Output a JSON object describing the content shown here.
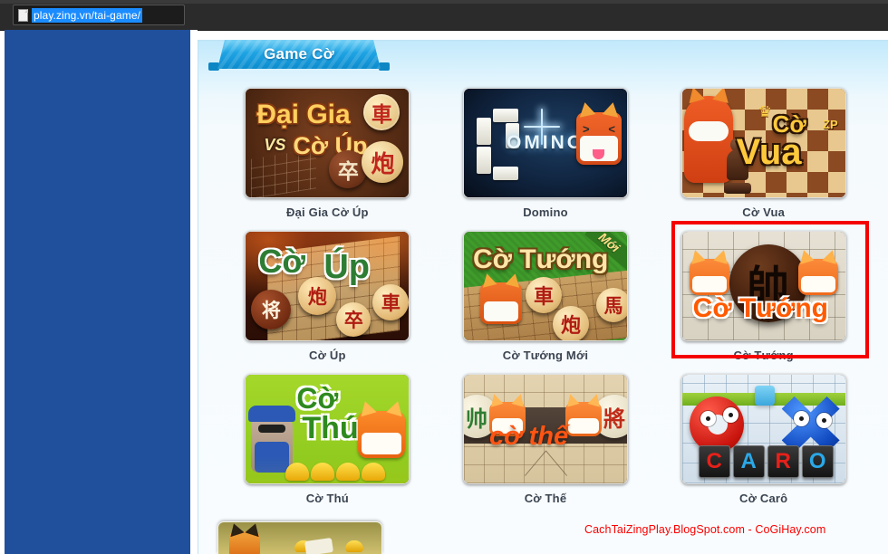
{
  "browser": {
    "url": "play.zing.vn/tai-game/",
    "page_icon": "document-icon"
  },
  "page": {
    "tab_label": "Game Cờ",
    "watermark": "CachTaiZingPlay.BlogSpot.com - CoGiHay.com"
  },
  "colors": {
    "sidebar": "#20509c",
    "tab_blue": "#1b9fe0",
    "panel_top": "#c2e9fb",
    "panel_body": "#f5fafd",
    "highlight_red": "#f50000",
    "watermark_red": "#fb0000",
    "label_text": "#3b4450"
  },
  "games": [
    {
      "label": "Đại Gia Cờ Úp",
      "art": {
        "title_line1": "Đại Gia",
        "title_line2": "Cờ Úp",
        "vs": "VS",
        "piece1": "車",
        "piece2": "卒",
        "piece3": "炮"
      },
      "selected": false
    },
    {
      "label": "Domino",
      "art": {
        "wordmark": "OMINO"
      },
      "selected": false
    },
    {
      "label": "Cờ Vua",
      "art": {
        "title_line1": "Cờ",
        "title_line2": "Vua",
        "crown": "♛",
        "badge": "ZP"
      },
      "selected": false
    },
    {
      "label": "Cờ Úp",
      "art": {
        "title_line1": "Cờ",
        "title_line2": "Úp",
        "piece1": "将",
        "piece2": "炮",
        "piece3": "卒",
        "piece4": "車"
      },
      "selected": false
    },
    {
      "label": "Cờ Tướng Mới",
      "art": {
        "title": "Cờ Tướng",
        "ribbon": "Mới",
        "piece1": "車",
        "piece2": "馬",
        "piece3": "炮"
      },
      "selected": false
    },
    {
      "label": "Cờ Tướng",
      "art": {
        "title": "Cờ Tướng",
        "piece_center": "帥"
      },
      "selected": true
    },
    {
      "label": "Cờ Thú",
      "art": {
        "title_line1": "Cờ",
        "title_line2": "Thú"
      },
      "selected": false
    },
    {
      "label": "Cờ Thế",
      "art": {
        "title": "cờ thế",
        "piece_left": "帅",
        "piece_right": "將"
      },
      "selected": false
    },
    {
      "label": "Cờ Carô",
      "art": {
        "letters": [
          "C",
          "A",
          "R",
          "O"
        ],
        "letter_colors": [
          "#e8201a",
          "#2aa8e8",
          "#e8201a",
          "#2aa8e8"
        ]
      },
      "selected": false
    }
  ]
}
